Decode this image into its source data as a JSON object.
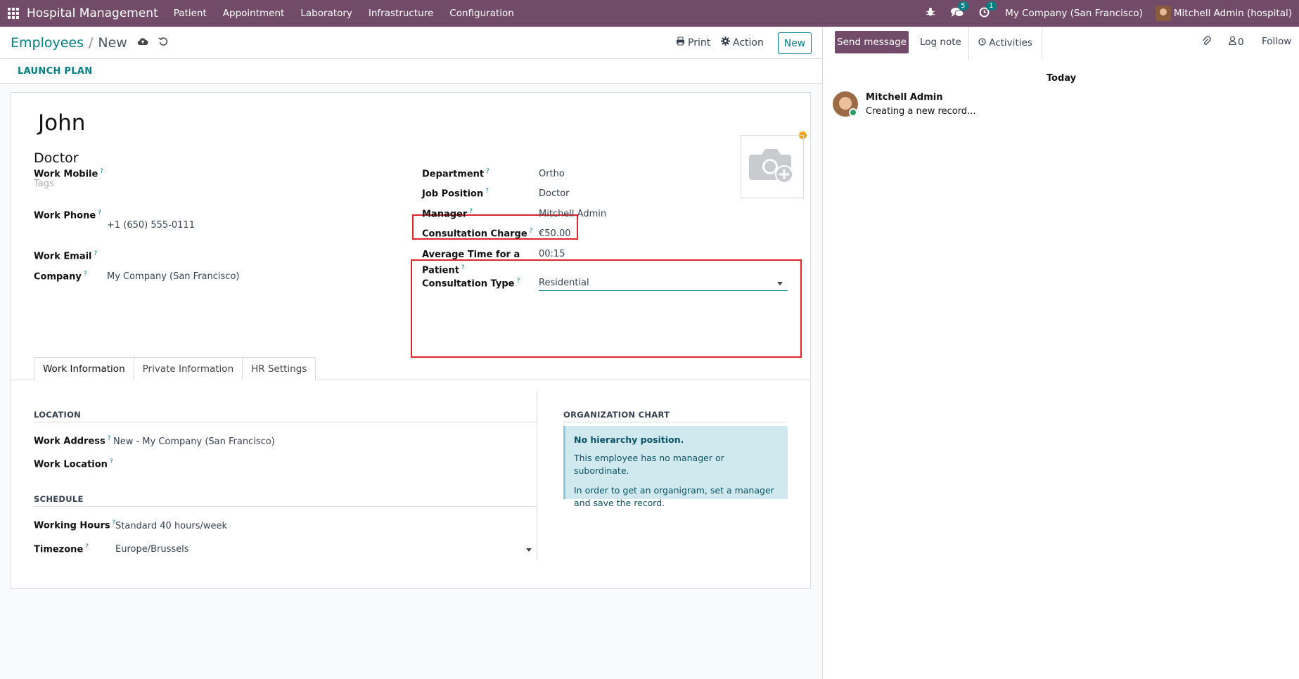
{
  "navbar": {
    "brand": "Hospital Management",
    "menu": [
      "Patient",
      "Appointment",
      "Laboratory",
      "Infrastructure",
      "Configuration"
    ],
    "messages_count": "5",
    "activities_count": "1",
    "company": "My Company (San Francisco)",
    "user": "Mitchell Admin (hospital)"
  },
  "control": {
    "breadcrumb_parent": "Employees",
    "breadcrumb_sep": "/",
    "breadcrumb_current": "New",
    "print_label": "Print",
    "action_label": "Action",
    "new_label": "New"
  },
  "statusbar": {
    "launch_plan": "LAUNCH PLAN"
  },
  "employee": {
    "name": "John",
    "job_title": "Doctor",
    "tags_placeholder": "Tags"
  },
  "fields_left": {
    "work_mobile_label": "Work Mobile",
    "work_phone_label": "Work Phone",
    "work_phone_value": "+1 (650) 555-0111",
    "work_email_label": "Work Email",
    "company_label": "Company",
    "company_value": "My Company (San Francisco)"
  },
  "fields_right": {
    "department_label": "Department",
    "department_value": "Ortho",
    "job_position_label": "Job Position",
    "job_position_value": "Doctor",
    "manager_label": "Manager",
    "manager_value": "Mitchell Admin",
    "consult_charge_label": "Consultation Charge",
    "consult_charge_value": "€50.00",
    "avg_time_label_1": "Average Time for a",
    "avg_time_label_2": "Patient",
    "avg_time_value": "00:15",
    "consult_type_label": "Consultation Type",
    "consult_type_value": "Residential"
  },
  "tabs": [
    "Work Information",
    "Private Information",
    "HR Settings"
  ],
  "work_info": {
    "location_title": "LOCATION",
    "work_address_label": "Work Address",
    "work_address_value": "New - My Company (San Francisco)",
    "work_location_label": "Work Location",
    "schedule_title": "SCHEDULE",
    "working_hours_label": "Working Hours",
    "working_hours_value": "Standard 40 hours/week",
    "timezone_label": "Timezone",
    "timezone_value": "Europe/Brussels",
    "org_chart_title": "ORGANIZATION CHART",
    "org_head": "No hierarchy position.",
    "org_p1": "This employee has no manager or subordinate.",
    "org_p2": "In order to get an organigram, set a manager and save the record."
  },
  "chatter": {
    "send_message": "Send message",
    "log_note": "Log note",
    "activities": "Activities",
    "followers_count": "0",
    "follow": "Follow",
    "today": "Today",
    "author": "Mitchell Admin",
    "body": "Creating a new record..."
  },
  "colors": {
    "brand": "#714B67",
    "accent": "#017E84",
    "highlight": "#e0262d"
  }
}
